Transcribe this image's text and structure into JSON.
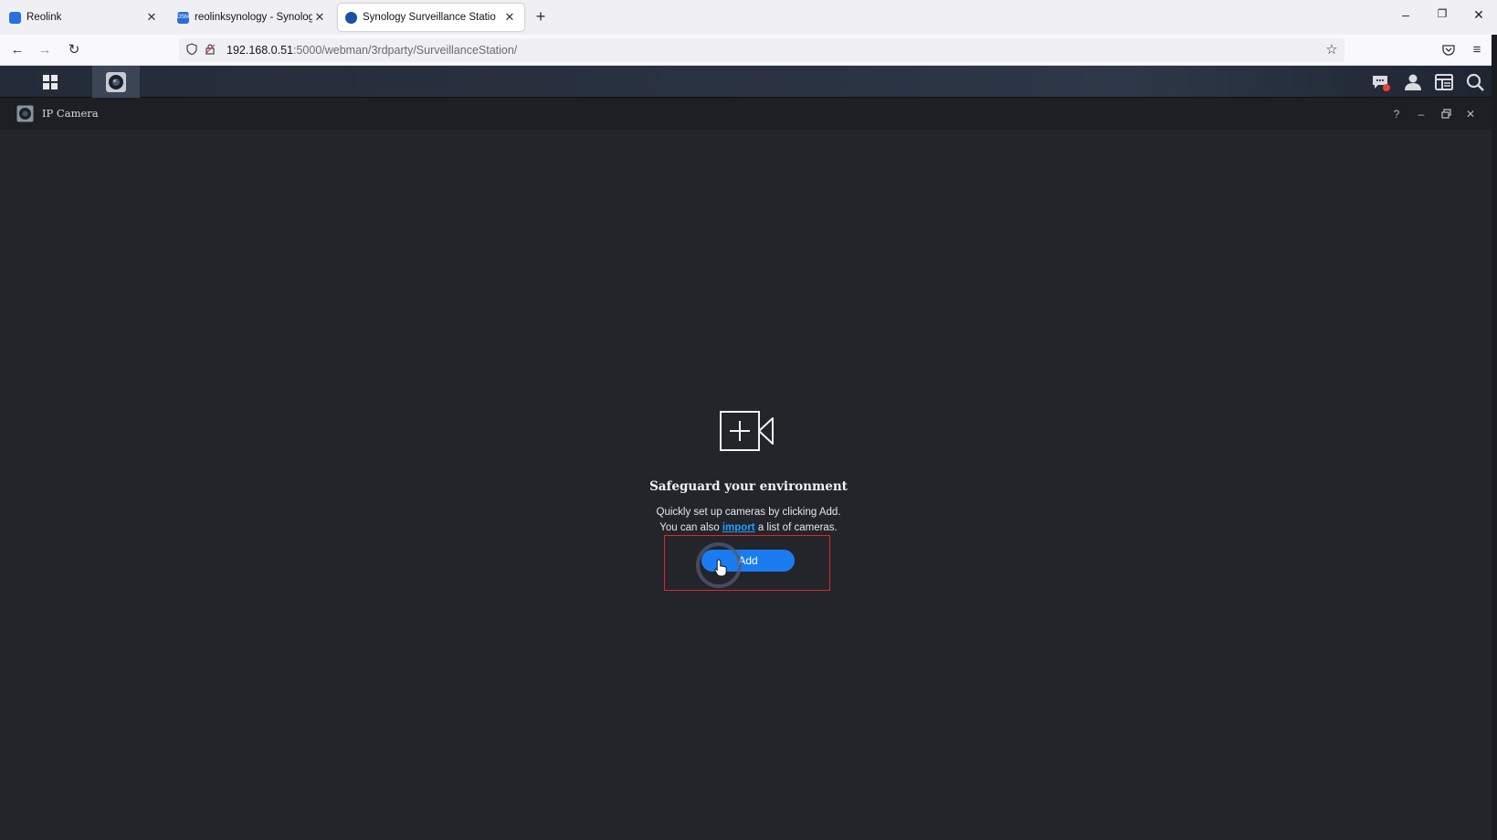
{
  "browser": {
    "tabs": [
      {
        "title": "Reolink",
        "active": false,
        "favicon_color": "#2a6fdb"
      },
      {
        "title": "reolinksynology - Synology N",
        "active": false,
        "favicon_color": "#2a6fdb",
        "favicon_text": "DSM"
      },
      {
        "title": "Synology Surveillance Statio",
        "active": true,
        "favicon_color": "#1b4fa8"
      }
    ],
    "new_tab_label": "+",
    "url_host": "192.168.0.51",
    "url_path": ":5000/webman/3rdparty/SurveillanceStation/"
  },
  "window": {
    "title": "IP Camera",
    "help_label": "?"
  },
  "empty_state": {
    "heading": "Safeguard your environment",
    "line1": "Quickly set up cameras by clicking Add.",
    "line2_prefix": "You can also ",
    "line2_link": "import",
    "line2_suffix": " a list of cameras.",
    "add_button": "Add"
  },
  "icons": {
    "back": "arrow-left-icon",
    "forward": "arrow-right-icon",
    "reload": "reload-icon",
    "bookmark": "star-icon",
    "pocket": "pocket-icon",
    "menu": "hamburger-icon",
    "main_menu": "grid-icon",
    "surveillance": "camera-lens-icon",
    "notifications": "chat-notification-icon",
    "user": "user-icon",
    "widgets": "widgets-icon",
    "search": "search-icon",
    "add_camera": "camera-plus-icon"
  },
  "colors": {
    "accent": "#1b7cf2",
    "link": "#1aa0ff",
    "highlight": "#e02828",
    "notification_dot": "#e8413a"
  }
}
